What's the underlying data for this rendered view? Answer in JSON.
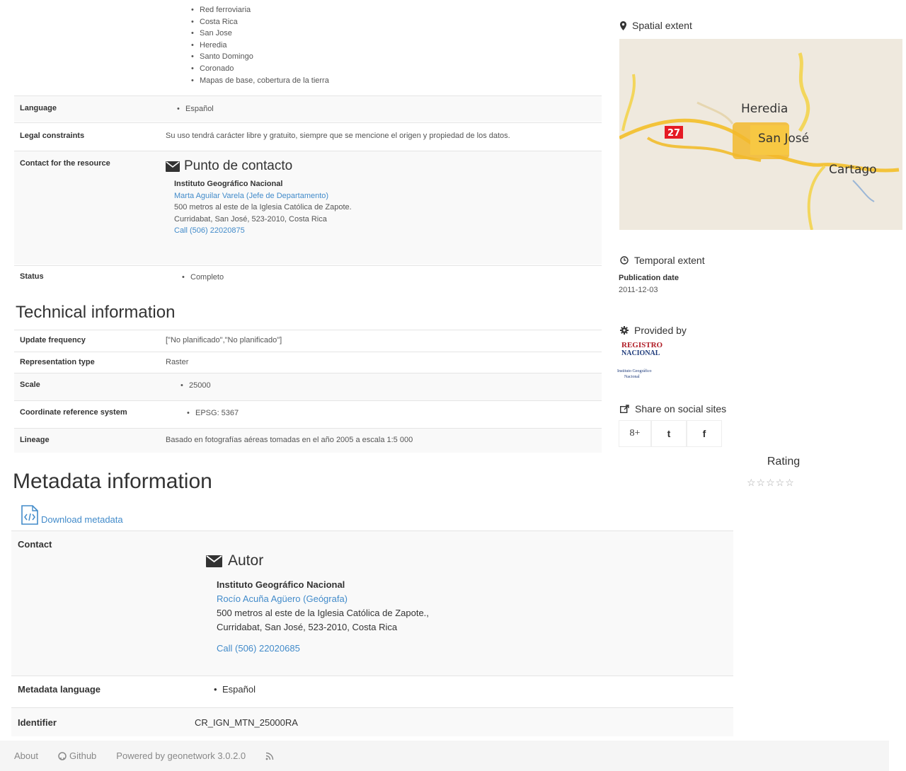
{
  "keywords": [
    "Red ferroviaria",
    "Costa Rica",
    "San Jose",
    "Heredia",
    "Santo Domingo",
    "Coronado",
    "Mapas de base, cobertura de la tierra"
  ],
  "details": {
    "language_label": "Language",
    "language_value": "Español",
    "legal_label": "Legal constraints",
    "legal_value": "Su uso tendrá carácter libre y gratuito, siempre que se mencione el origen y propiedad de los datos.",
    "contact_label": "Contact for the resource",
    "contact": {
      "title": "Punto de contacto",
      "org": "Instituto Geográfico Nacional",
      "person": "Marta Aguilar Varela (Jefe de Departamento)",
      "address1": "500 metros al este de la Iglesia Católica de Zapote.",
      "address2": "Curridabat, San José, 523-2010, Costa Rica",
      "phone": "Call (506) 22020875"
    },
    "status_label": "Status",
    "status_value": "Completo"
  },
  "technical": {
    "heading": "Technical information",
    "update_label": "Update frequency",
    "update_value": "[\"No planificado\",\"No planificado\"]",
    "rep_label": "Representation type",
    "rep_value": "Raster",
    "scale_label": "Scale",
    "scale_value": "25000",
    "crs_label": "Coordinate reference system",
    "crs_value": "EPSG: 5367",
    "lineage_label": "Lineage",
    "lineage_value": "Basado en fotografías aéreas tomadas en el año 2005 a escala 1:5 000"
  },
  "sidebar": {
    "spatial": "Spatial extent",
    "map_labels": {
      "heredia": "Heredia",
      "sanjose": "San José",
      "cartago": "Cartago",
      "route": "27"
    },
    "temporal": "Temporal extent",
    "pub_label": "Publication date",
    "pub_value": "2011-12-03",
    "provided": "Provided by",
    "logo_lines": [
      "REGISTRO",
      "NACIONAL",
      "Instituto Geográfico",
      "Nacional"
    ],
    "share": "Share on social sites",
    "social": [
      "8+",
      "t",
      "f"
    ],
    "rating": "Rating",
    "stars": "☆☆☆☆☆"
  },
  "metadata": {
    "heading": "Metadata information",
    "download": "Download metadata",
    "contact_label": "Contact",
    "contact": {
      "title": "Autor",
      "org": "Instituto Geográfico Nacional",
      "person": "Rocío Acuña Agüero (Geógrafa)",
      "address1": "500 metros al este de la Iglesia Católica de Zapote.,",
      "address2": "Curridabat, San José, 523-2010, Costa Rica",
      "phone": "Call (506) 22020685"
    },
    "lang_label": "Metadata language",
    "lang_value": "Español",
    "id_label": "Identifier",
    "id_value": "CR_IGN_MTN_25000RA"
  },
  "footer": {
    "about": "About",
    "github": "Github",
    "powered": "Powered by geonetwork 3.0.2.0"
  }
}
